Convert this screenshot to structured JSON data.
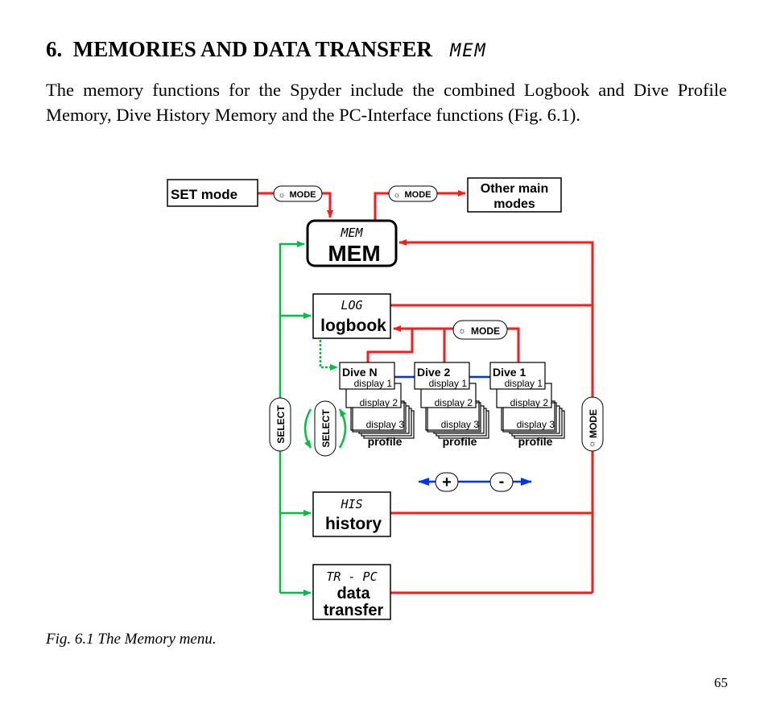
{
  "heading": {
    "number": "6.",
    "text": "MEMORIES AND DATA TRANSFER",
    "lcd": "MEM"
  },
  "intro": "The memory functions for the Spyder include the combined Logbook and Dive Profile Memory, Dive History Memory and the PC-Interface functions (Fig. 6.1).",
  "diagram": {
    "set_mode": "SET mode",
    "other_modes_1": "Other main",
    "other_modes_2": "modes",
    "mode_btn": "MODE",
    "select_btn": "SELECT",
    "mem": {
      "lcd": "MEM",
      "label": "MEM"
    },
    "logbook": {
      "lcd": "LOG",
      "label": "logbook"
    },
    "history": {
      "lcd": "HIS",
      "label": "history"
    },
    "transfer": {
      "lcd": "TR - PC",
      "label1": "data",
      "label2": "transfer"
    },
    "dives": [
      {
        "name": "Dive N",
        "d1": "display 1",
        "d2": "display 2",
        "d3": "display 3",
        "profile": "profile"
      },
      {
        "name": "Dive 2",
        "d1": "display 1",
        "d2": "display 2",
        "d3": "display 3",
        "profile": "profile"
      },
      {
        "name": "Dive 1",
        "d1": "display 1",
        "d2": "display 2",
        "d3": "display 3",
        "profile": "profile"
      }
    ],
    "plus": "+",
    "minus": "-",
    "colors": {
      "red": "#ff1a1a",
      "green": "#00c040",
      "blue": "#0033ff"
    }
  },
  "caption": "Fig. 6.1 The Memory menu.",
  "page_number": "65"
}
